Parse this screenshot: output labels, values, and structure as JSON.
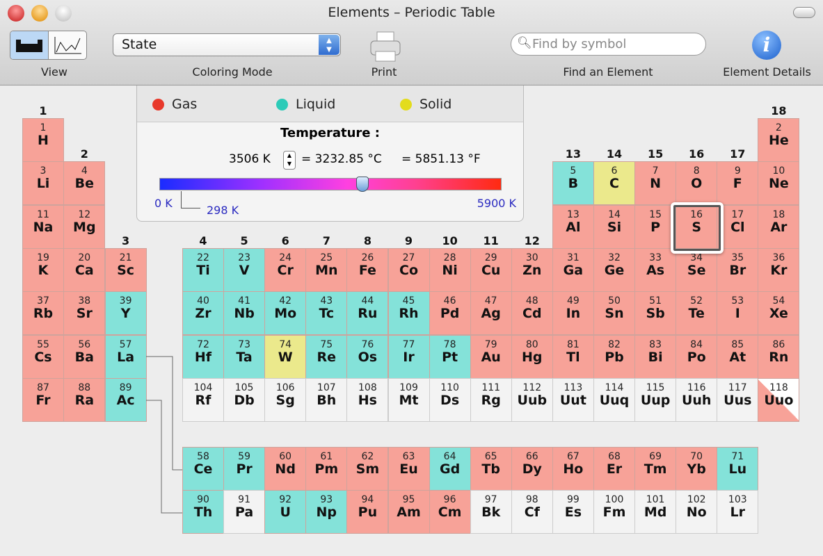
{
  "window": {
    "title": "Elements – Periodic Table"
  },
  "toolbar": {
    "view_label": "View",
    "coloring_label": "Coloring Mode",
    "coloring_value": "State",
    "print_label": "Print",
    "search_placeholder": "Find by symbol",
    "find_label": "Find an Element",
    "details_label": "Element Details"
  },
  "legend": {
    "gas": "Gas",
    "liquid": "Liquid",
    "solid": "Solid",
    "temperature_label": "Temperature :",
    "kelvin": "3506 K",
    "celsius": "= 3232.85 °C",
    "fahrenheit": "= 5851.13 °F",
    "min": "0 K",
    "room": "298 K",
    "max": "5900 K",
    "slider_value_k": 3506,
    "slider_max_k": 5900
  },
  "colors": {
    "gas": "#f7a298",
    "liquid": "#84e2d9",
    "solid": "#ebe98c",
    "unknown": "#f3f3f3",
    "gas_dot": "#e8392b",
    "liquid_dot": "#2ccbb8",
    "solid_dot": "#e3dc1c"
  },
  "selected": "S",
  "groups": [
    "1",
    "2",
    "3",
    "4",
    "5",
    "6",
    "7",
    "8",
    "9",
    "10",
    "11",
    "12",
    "13",
    "14",
    "15",
    "16",
    "17",
    "18"
  ],
  "elements": [
    [
      1,
      "H",
      1,
      1,
      "g"
    ],
    [
      2,
      "He",
      1,
      18,
      "g"
    ],
    [
      3,
      "Li",
      2,
      1,
      "g"
    ],
    [
      4,
      "Be",
      2,
      2,
      "g"
    ],
    [
      5,
      "B",
      2,
      13,
      "l"
    ],
    [
      6,
      "C",
      2,
      14,
      "s"
    ],
    [
      7,
      "N",
      2,
      15,
      "g"
    ],
    [
      8,
      "O",
      2,
      16,
      "g"
    ],
    [
      9,
      "F",
      2,
      17,
      "g"
    ],
    [
      10,
      "Ne",
      2,
      18,
      "g"
    ],
    [
      11,
      "Na",
      3,
      1,
      "g"
    ],
    [
      12,
      "Mg",
      3,
      2,
      "g"
    ],
    [
      13,
      "Al",
      3,
      13,
      "g"
    ],
    [
      14,
      "Si",
      3,
      14,
      "g"
    ],
    [
      15,
      "P",
      3,
      15,
      "g"
    ],
    [
      16,
      "S",
      3,
      16,
      "g"
    ],
    [
      17,
      "Cl",
      3,
      17,
      "g"
    ],
    [
      18,
      "Ar",
      3,
      18,
      "g"
    ],
    [
      19,
      "K",
      4,
      1,
      "g"
    ],
    [
      20,
      "Ca",
      4,
      2,
      "g"
    ],
    [
      21,
      "Sc",
      4,
      3,
      "g"
    ],
    [
      22,
      "Ti",
      4,
      4,
      "l"
    ],
    [
      23,
      "V",
      4,
      5,
      "l"
    ],
    [
      24,
      "Cr",
      4,
      6,
      "g"
    ],
    [
      25,
      "Mn",
      4,
      7,
      "g"
    ],
    [
      26,
      "Fe",
      4,
      8,
      "g"
    ],
    [
      27,
      "Co",
      4,
      9,
      "g"
    ],
    [
      28,
      "Ni",
      4,
      10,
      "g"
    ],
    [
      29,
      "Cu",
      4,
      11,
      "g"
    ],
    [
      30,
      "Zn",
      4,
      12,
      "g"
    ],
    [
      31,
      "Ga",
      4,
      13,
      "g"
    ],
    [
      32,
      "Ge",
      4,
      14,
      "g"
    ],
    [
      33,
      "As",
      4,
      15,
      "g"
    ],
    [
      34,
      "Se",
      4,
      16,
      "g"
    ],
    [
      35,
      "Br",
      4,
      17,
      "g"
    ],
    [
      36,
      "Kr",
      4,
      18,
      "g"
    ],
    [
      37,
      "Rb",
      5,
      1,
      "g"
    ],
    [
      38,
      "Sr",
      5,
      2,
      "g"
    ],
    [
      39,
      "Y",
      5,
      3,
      "l"
    ],
    [
      40,
      "Zr",
      5,
      4,
      "l"
    ],
    [
      41,
      "Nb",
      5,
      5,
      "l"
    ],
    [
      42,
      "Mo",
      5,
      6,
      "l"
    ],
    [
      43,
      "Tc",
      5,
      7,
      "l"
    ],
    [
      44,
      "Ru",
      5,
      8,
      "l"
    ],
    [
      45,
      "Rh",
      5,
      9,
      "l"
    ],
    [
      46,
      "Pd",
      5,
      10,
      "g"
    ],
    [
      47,
      "Ag",
      5,
      11,
      "g"
    ],
    [
      48,
      "Cd",
      5,
      12,
      "g"
    ],
    [
      49,
      "In",
      5,
      13,
      "g"
    ],
    [
      50,
      "Sn",
      5,
      14,
      "g"
    ],
    [
      51,
      "Sb",
      5,
      15,
      "g"
    ],
    [
      52,
      "Te",
      5,
      16,
      "g"
    ],
    [
      53,
      "I",
      5,
      17,
      "g"
    ],
    [
      54,
      "Xe",
      5,
      18,
      "g"
    ],
    [
      55,
      "Cs",
      6,
      1,
      "g"
    ],
    [
      56,
      "Ba",
      6,
      2,
      "g"
    ],
    [
      57,
      "La",
      6,
      3,
      "l"
    ],
    [
      72,
      "Hf",
      6,
      4,
      "l"
    ],
    [
      73,
      "Ta",
      6,
      5,
      "l"
    ],
    [
      74,
      "W",
      6,
      6,
      "s"
    ],
    [
      75,
      "Re",
      6,
      7,
      "l"
    ],
    [
      76,
      "Os",
      6,
      8,
      "l"
    ],
    [
      77,
      "Ir",
      6,
      9,
      "l"
    ],
    [
      78,
      "Pt",
      6,
      10,
      "l"
    ],
    [
      79,
      "Au",
      6,
      11,
      "g"
    ],
    [
      80,
      "Hg",
      6,
      12,
      "g"
    ],
    [
      81,
      "Tl",
      6,
      13,
      "g"
    ],
    [
      82,
      "Pb",
      6,
      14,
      "g"
    ],
    [
      83,
      "Bi",
      6,
      15,
      "g"
    ],
    [
      84,
      "Po",
      6,
      16,
      "g"
    ],
    [
      85,
      "At",
      6,
      17,
      "g"
    ],
    [
      86,
      "Rn",
      6,
      18,
      "g"
    ],
    [
      87,
      "Fr",
      7,
      1,
      "g"
    ],
    [
      88,
      "Ra",
      7,
      2,
      "g"
    ],
    [
      89,
      "Ac",
      7,
      3,
      "l"
    ],
    [
      104,
      "Rf",
      7,
      4,
      "u"
    ],
    [
      105,
      "Db",
      7,
      5,
      "u"
    ],
    [
      106,
      "Sg",
      7,
      6,
      "u"
    ],
    [
      107,
      "Bh",
      7,
      7,
      "u"
    ],
    [
      108,
      "Hs",
      7,
      8,
      "u"
    ],
    [
      109,
      "Mt",
      7,
      9,
      "u"
    ],
    [
      110,
      "Ds",
      7,
      10,
      "u"
    ],
    [
      111,
      "Rg",
      7,
      11,
      "u"
    ],
    [
      112,
      "Uub",
      7,
      12,
      "u"
    ],
    [
      113,
      "Uut",
      7,
      13,
      "u"
    ],
    [
      114,
      "Uuq",
      7,
      14,
      "u"
    ],
    [
      115,
      "Uup",
      7,
      15,
      "u"
    ],
    [
      116,
      "Uuh",
      7,
      16,
      "u"
    ],
    [
      117,
      "Uus",
      7,
      17,
      "u"
    ],
    [
      118,
      "Uuo",
      7,
      18,
      "h"
    ],
    [
      58,
      "Ce",
      9,
      4,
      "l"
    ],
    [
      59,
      "Pr",
      9,
      5,
      "l"
    ],
    [
      60,
      "Nd",
      9,
      6,
      "g"
    ],
    [
      61,
      "Pm",
      9,
      7,
      "g"
    ],
    [
      62,
      "Sm",
      9,
      8,
      "g"
    ],
    [
      63,
      "Eu",
      9,
      9,
      "g"
    ],
    [
      64,
      "Gd",
      9,
      10,
      "l"
    ],
    [
      65,
      "Tb",
      9,
      11,
      "g"
    ],
    [
      66,
      "Dy",
      9,
      12,
      "g"
    ],
    [
      67,
      "Ho",
      9,
      13,
      "g"
    ],
    [
      68,
      "Er",
      9,
      14,
      "g"
    ],
    [
      69,
      "Tm",
      9,
      15,
      "g"
    ],
    [
      70,
      "Yb",
      9,
      16,
      "g"
    ],
    [
      71,
      "Lu",
      9,
      17,
      "l"
    ],
    [
      90,
      "Th",
      10,
      4,
      "l"
    ],
    [
      91,
      "Pa",
      10,
      5,
      "u"
    ],
    [
      92,
      "U",
      10,
      6,
      "l"
    ],
    [
      93,
      "Np",
      10,
      7,
      "l"
    ],
    [
      94,
      "Pu",
      10,
      8,
      "g"
    ],
    [
      95,
      "Am",
      10,
      9,
      "g"
    ],
    [
      96,
      "Cm",
      10,
      10,
      "g"
    ],
    [
      97,
      "Bk",
      10,
      11,
      "u"
    ],
    [
      98,
      "Cf",
      10,
      12,
      "u"
    ],
    [
      99,
      "Es",
      10,
      13,
      "u"
    ],
    [
      100,
      "Fm",
      10,
      14,
      "u"
    ],
    [
      101,
      "Md",
      10,
      15,
      "u"
    ],
    [
      102,
      "No",
      10,
      16,
      "u"
    ],
    [
      103,
      "Lr",
      10,
      17,
      "u"
    ]
  ]
}
